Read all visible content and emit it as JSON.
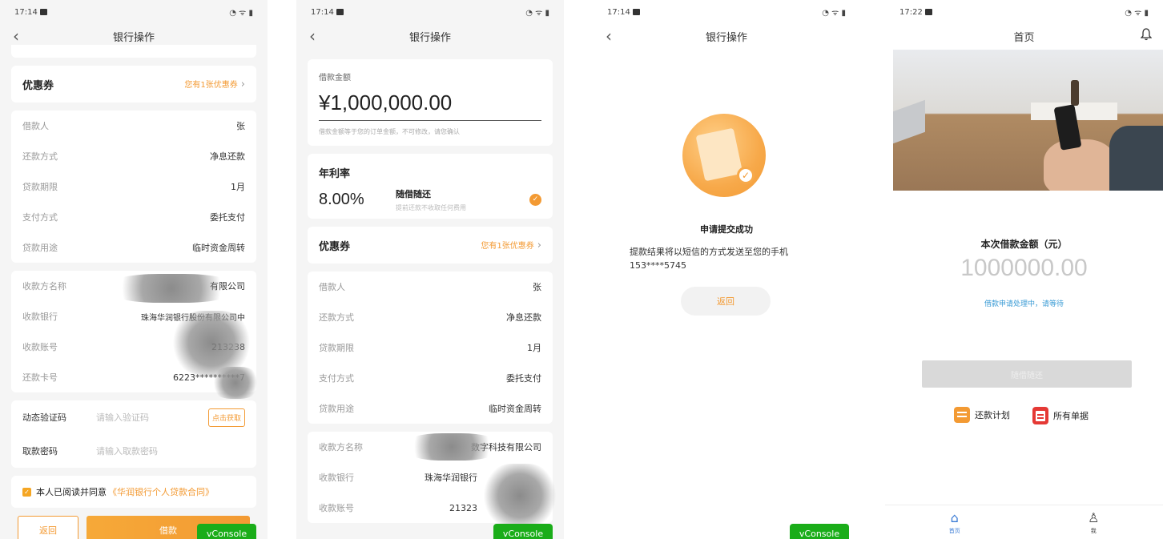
{
  "screen1": {
    "status_time": "17:14",
    "nav_title": "银行操作",
    "coupon_label": "优惠券",
    "coupon_value": "您有1张优惠券",
    "info_rows": [
      {
        "k": "借款人",
        "v": "张"
      },
      {
        "k": "还款方式",
        "v": "净息还款"
      },
      {
        "k": "贷款期限",
        "v": "1月"
      },
      {
        "k": "支付方式",
        "v": "委托支付"
      },
      {
        "k": "贷款用途",
        "v": "临时资金周转"
      }
    ],
    "payee_rows": [
      {
        "k": "收款方名称",
        "v": "有限公司"
      },
      {
        "k": "收款银行",
        "v": "珠海华润银行股份有限公司中"
      },
      {
        "k": "收款账号",
        "v": "213238"
      },
      {
        "k": "还款卡号",
        "v": "6223**********7"
      }
    ],
    "verify_label": "动态验证码",
    "verify_placeholder": "请输入验证码",
    "verify_button": "点击获取",
    "pwd_label": "取款密码",
    "pwd_placeholder": "请输入取款密码",
    "agree_text": "本人已阅读并同意",
    "agree_link": "《华润银行个人贷款合同》",
    "return_button": "返回",
    "loan_button": "借款",
    "vconsole": "vConsole"
  },
  "screen2": {
    "status_time": "17:14",
    "nav_title": "银行操作",
    "amount_label": "借款金额",
    "amount_value": "¥1,000,000.00",
    "amount_note": "借款金额等于您的订单金额，不可修改，请您确认",
    "rate_title": "年利率",
    "rate_value": "8.00%",
    "rate_plan": "随借随还",
    "rate_plan_note": "提前还款不收取任何费用",
    "coupon_label": "优惠券",
    "coupon_value": "您有1张优惠券",
    "info_rows": [
      {
        "k": "借款人",
        "v": "张"
      },
      {
        "k": "还款方式",
        "v": "净息还款"
      },
      {
        "k": "贷款期限",
        "v": "1月"
      },
      {
        "k": "支付方式",
        "v": "委托支付"
      },
      {
        "k": "贷款用途",
        "v": "临时资金周转"
      }
    ],
    "payee_rows": [
      {
        "k": "收款方名称",
        "v": "数字科技有限公司"
      },
      {
        "k": "收款银行",
        "v": "珠海华润银行"
      },
      {
        "k": "收款账号",
        "v": "21323"
      }
    ],
    "vconsole": "vConsole"
  },
  "screen3": {
    "status_time": "17:14",
    "nav_title": "银行操作",
    "success_title": "申请提交成功",
    "success_msg": "提款结果将以短信的方式发送至您的手机",
    "phone": "153****5745",
    "return_button": "返回",
    "vconsole": "vConsole"
  },
  "screen4": {
    "status_time": "17:22",
    "nav_title": "首页",
    "amount_label": "本次借款金额（元）",
    "amount_value": "1000000.00",
    "status_text": "借款申请处理中，请等待",
    "disabled_button": "随借随还",
    "repay_plan": "还款计划",
    "all_docs": "所有单据",
    "tab_home": "首页",
    "tab_me": "我"
  },
  "colors": {
    "accent": "#f39a33",
    "link": "#3a9bd5",
    "vconsole": "#1aad19"
  }
}
